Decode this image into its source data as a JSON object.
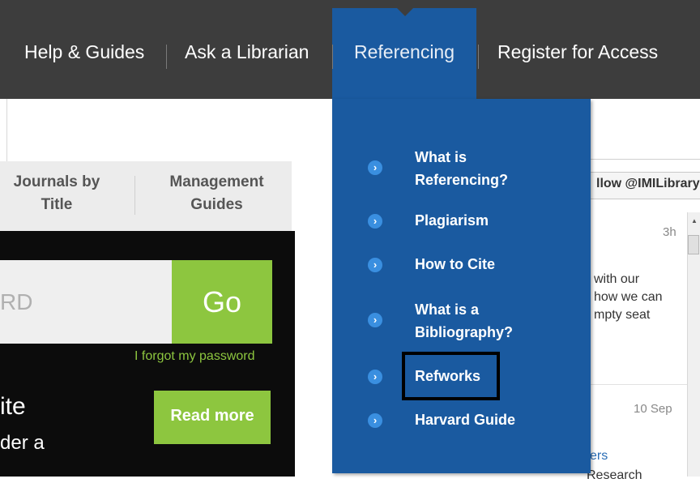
{
  "nav": {
    "help": "Help & Guides",
    "ask": "Ask a Librarian",
    "referencing": "Referencing",
    "register": "Register for Access"
  },
  "tabs": {
    "journals": "Journals by Title",
    "management": "Management Guides"
  },
  "search": {
    "partial_text": "RD",
    "go": "Go",
    "forgot": "I forgot my password"
  },
  "promo": {
    "title_partial": "ite",
    "sub_partial": "der a",
    "read_more": "Read more"
  },
  "twitter": {
    "follow": "llow @IMILibrary",
    "tweet1_time": "3h",
    "tweet1_text": "with our\nhow we can\nmpty seat",
    "tweet2_time": "10 Sep",
    "tweet2_link": "ers",
    "tweet2_text": "Research"
  },
  "dropdown": {
    "items": [
      {
        "label": "What is Referencing?"
      },
      {
        "label": "Plagiarism"
      },
      {
        "label": "How to Cite"
      },
      {
        "label": "What is a Bibliography?"
      },
      {
        "label": "Refworks",
        "highlighted": true
      },
      {
        "label": "Harvard Guide"
      }
    ],
    "bullet": "›"
  },
  "colors": {
    "nav_bg": "#3d3d3d",
    "dropdown_bg": "#1a5aa0",
    "accent_green": "#8dc63f",
    "bullet_blue": "#3a8fe0"
  }
}
